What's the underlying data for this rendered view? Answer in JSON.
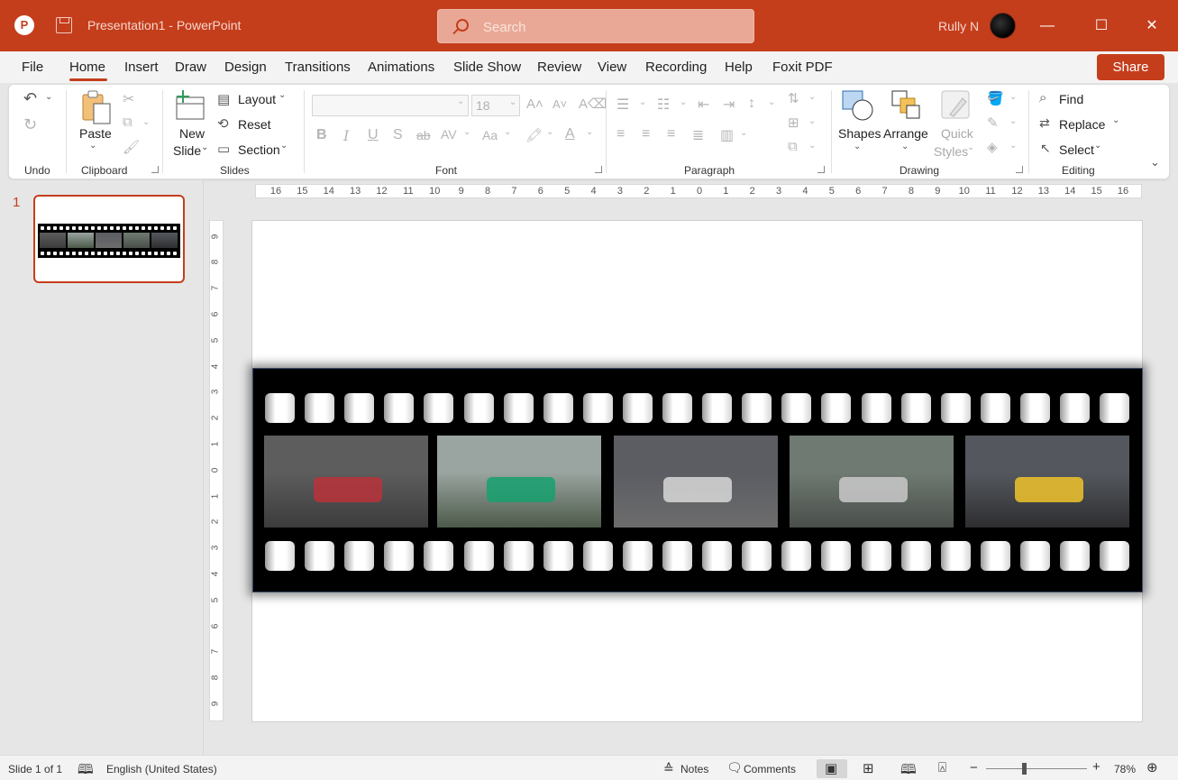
{
  "window": {
    "app_name": "PowerPoint",
    "doc_title": "Presentation1  -  PowerPoint",
    "search_placeholder": "Search",
    "user_name": "Rully N",
    "minimize_glyph": "—",
    "maximize_glyph": "☐",
    "close_glyph": "✕"
  },
  "menu": {
    "tabs": [
      "File",
      "Home",
      "Insert",
      "Draw",
      "Design",
      "Transitions",
      "Animations",
      "Slide Show",
      "Review",
      "View",
      "Recording",
      "Help",
      "Foxit PDF"
    ],
    "share_label": "Share"
  },
  "ribbon": {
    "undo": {
      "group": "Undo"
    },
    "clipboard": {
      "group": "Clipboard",
      "paste": "Paste"
    },
    "slides": {
      "group": "Slides",
      "new_slide_1": "New",
      "new_slide_2": "Slide",
      "layout": "Layout",
      "reset": "Reset",
      "section": "Section"
    },
    "font": {
      "group": "Font",
      "size_placeholder": "18"
    },
    "paragraph": {
      "group": "Paragraph"
    },
    "drawing": {
      "group": "Drawing",
      "shapes": "Shapes",
      "arrange": "Arrange",
      "quick_styles_1": "Quick",
      "quick_styles_2": "Styles"
    },
    "editing": {
      "group": "Editing",
      "find": "Find",
      "replace": "Replace",
      "select": "Select"
    }
  },
  "thumbnails": {
    "slide_number": "1"
  },
  "ruler": {
    "h_labels": [
      "16",
      "15",
      "14",
      "13",
      "12",
      "11",
      "10",
      "9",
      "8",
      "7",
      "6",
      "5",
      "4",
      "3",
      "2",
      "1",
      "0",
      "1",
      "2",
      "3",
      "4",
      "5",
      "6",
      "7",
      "8",
      "9",
      "10",
      "11",
      "12",
      "13",
      "14",
      "15",
      "16"
    ],
    "v_labels": [
      "9",
      "8",
      "7",
      "6",
      "5",
      "4",
      "3",
      "2",
      "1",
      "0",
      "1",
      "2",
      "3",
      "4",
      "5",
      "6",
      "7",
      "8",
      "9"
    ]
  },
  "slide": {
    "frames": [
      {
        "name": "f1-car-on-track",
        "sky": "#5d5d5d",
        "ground": "#3c3c3c",
        "accent": "#b8323a"
      },
      {
        "name": "f1-race-start",
        "sky": "#9aa4a0",
        "ground": "#4c5a4a",
        "accent": "#16a06e"
      },
      {
        "name": "haas-f1-car",
        "sky": "#5b5d63",
        "ground": "#6c6c6c",
        "accent": "#d8d8d8"
      },
      {
        "name": "stadium-aerial",
        "sky": "#6f7a72",
        "ground": "#4a4e4a",
        "accent": "#c9c9c9"
      },
      {
        "name": "onboard-cockpit",
        "sky": "#54585e",
        "ground": "#2e2e30",
        "accent": "#f0c32c"
      }
    ]
  },
  "status": {
    "slide_info": "Slide 1 of 1",
    "language": "English (United States)",
    "notes": "Notes",
    "comments": "Comments",
    "zoom": "78%"
  },
  "colors": {
    "accent": "#c43e1c",
    "titlebar": "#c43e1c"
  }
}
